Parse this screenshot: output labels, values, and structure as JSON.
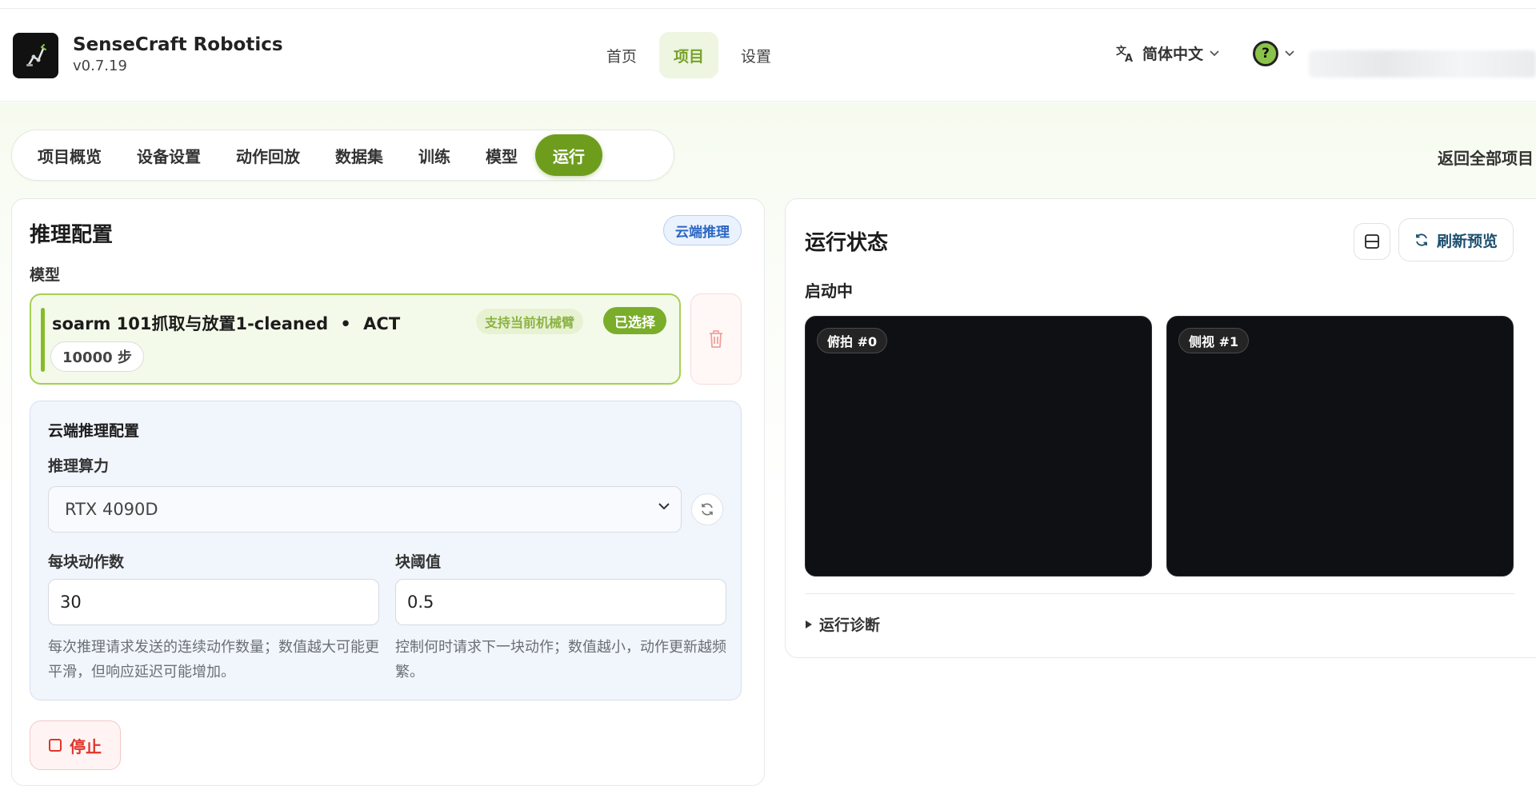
{
  "app": {
    "title": "SenseCraft Robotics",
    "version": "v0.7.19"
  },
  "topnav": {
    "items": [
      {
        "label": "首页",
        "active": false
      },
      {
        "label": "项目",
        "active": true
      },
      {
        "label": "设置",
        "active": false
      }
    ],
    "language": "简体中文",
    "help_icon": "question-icon"
  },
  "subnav": {
    "items": [
      {
        "label": "项目概览"
      },
      {
        "label": "设备设置"
      },
      {
        "label": "动作回放"
      },
      {
        "label": "数据集"
      },
      {
        "label": "训练"
      },
      {
        "label": "模型"
      },
      {
        "label": "运行",
        "active": true
      }
    ],
    "back_label": "返回全部项目"
  },
  "inference": {
    "title": "推理配置",
    "badge": "云端推理",
    "model_label": "模型",
    "model": {
      "name": "soarm 101抓取与放置1-cleaned",
      "separator": "•",
      "policy": "ACT",
      "steps": "10000 步",
      "support_tag": "支持当前机械臂",
      "selected_tag": "已选择"
    },
    "cloud": {
      "title": "云端推理配置",
      "compute_label": "推理算力",
      "compute_value": "RTX 4090D",
      "chunk_label": "每块动作数",
      "chunk_value": "30",
      "chunk_hint": "每次推理请求发送的连续动作数量；数值越大可能更平滑，但响应延迟可能增加。",
      "threshold_label": "块阈值",
      "threshold_value": "0.5",
      "threshold_hint": "控制何时请求下一块动作；数值越小，动作更新越频繁。"
    },
    "stop_label": "停止"
  },
  "run_status": {
    "title": "运行状态",
    "refresh_label": "刷新预览",
    "state": "启动中",
    "cameras": [
      {
        "label": "俯拍 #0"
      },
      {
        "label": "侧视 #1"
      }
    ],
    "diagnostics_label": "运行诊断"
  },
  "colors": {
    "accent": "#6e9d1e",
    "danger": "#e0352b",
    "cloud_blue": "#2c66c4"
  }
}
